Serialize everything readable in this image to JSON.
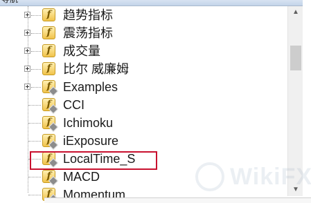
{
  "header": {
    "title": "导航"
  },
  "tree": {
    "items": [
      {
        "label": "趋势指标",
        "type": "folder"
      },
      {
        "label": "震荡指标",
        "type": "folder"
      },
      {
        "label": "成交量",
        "type": "folder"
      },
      {
        "label": "比尔 威廉姆",
        "type": "folder"
      },
      {
        "label": "Examples",
        "type": "folder"
      },
      {
        "label": "CCI",
        "type": "indicator"
      },
      {
        "label": "Ichimoku",
        "type": "indicator"
      },
      {
        "label": "iExposure",
        "type": "indicator"
      },
      {
        "label": "LocalTime_S",
        "type": "indicator",
        "highlighted": true
      },
      {
        "label": "MACD",
        "type": "indicator"
      },
      {
        "label": "Momentum",
        "type": "indicator"
      }
    ],
    "icon_glyph": "f",
    "icon_name": "function-icon"
  },
  "watermark": {
    "text": "WikiFX"
  },
  "colors": {
    "highlight_border": "#c8102e",
    "icon_fill": "#f1c34a"
  }
}
